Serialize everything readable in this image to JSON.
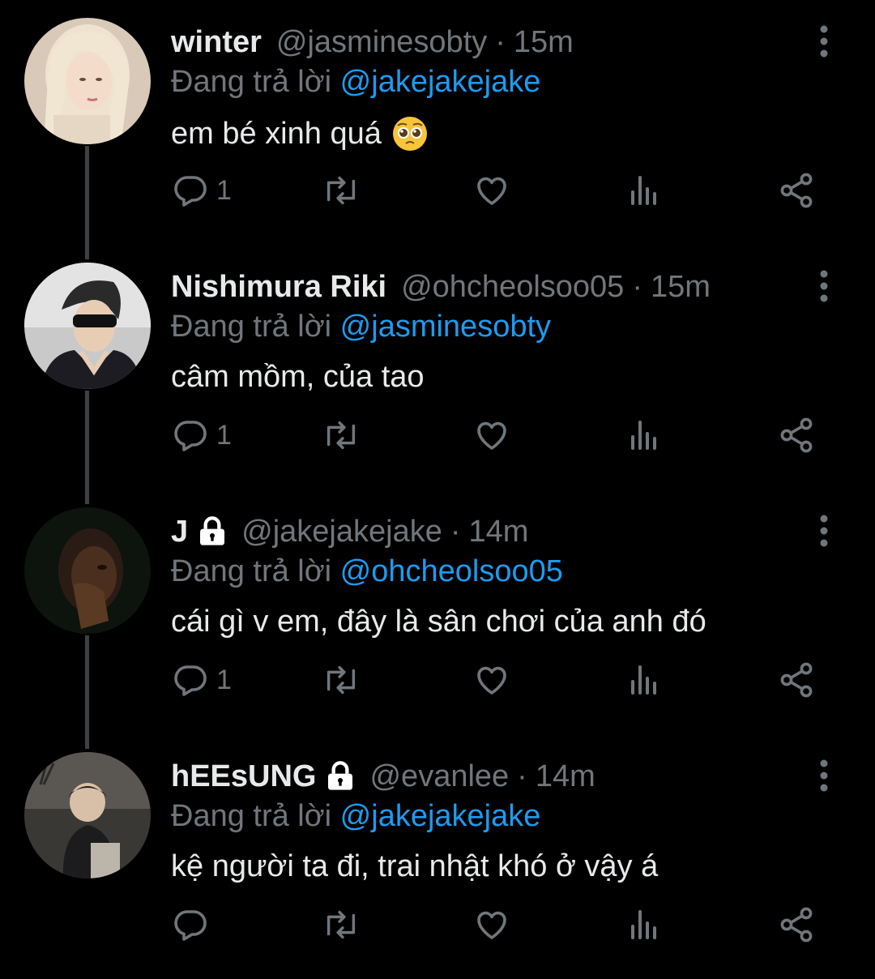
{
  "colors": {
    "background": "#000000",
    "name": "#e7e9ea",
    "meta": "#71767b",
    "mention": "#1d9bf0",
    "thread_line": "#3e4144"
  },
  "tweets": [
    {
      "name": "winter",
      "locked": false,
      "handle": "@jasminesobty",
      "time": "15m",
      "reply_prefix": "Đang trả lời",
      "reply_to": "@jakejakejake",
      "text": "em bé xinh quá",
      "emoji": "pleading-face",
      "reply_count": "1"
    },
    {
      "name": "Nishimura Riki",
      "locked": false,
      "handle": "@ohcheolsoo05",
      "time": "15m",
      "reply_prefix": "Đang trả lời",
      "reply_to": "@jasminesobty",
      "text": "câm mồm, của tao",
      "reply_count": "1"
    },
    {
      "name": "J",
      "locked": true,
      "handle": "@jakejakejake",
      "time": "14m",
      "reply_prefix": "Đang trả lời",
      "reply_to": "@ohcheolsoo05",
      "text": "cái gì v em, đây là sân chơi của anh đó",
      "reply_count": "1"
    },
    {
      "name": "hEEsUNG",
      "locked": true,
      "handle": "@evanlee",
      "time": "14m",
      "reply_prefix": "Đang trả lời",
      "reply_to": "@jakejakejake",
      "text": "kệ người ta đi, trai nhật khó ở vậy á",
      "reply_count": ""
    }
  ]
}
